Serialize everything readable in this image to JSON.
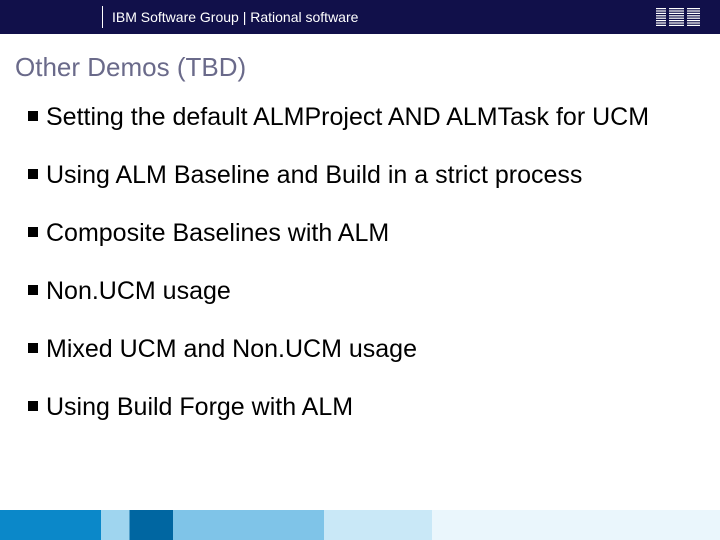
{
  "header": {
    "text": "IBM Software Group | Rational software",
    "logo_label": "IBM"
  },
  "title": "Other Demos (TBD)",
  "bullets": [
    "Setting the default ALMProject AND ALMTask for UCM",
    "Using ALM Baseline and Build in a strict process",
    "Composite Baselines with ALM",
    "Non.UCM usage",
    "Mixed UCM and Non.UCM usage",
    "Using Build Forge with ALM"
  ]
}
